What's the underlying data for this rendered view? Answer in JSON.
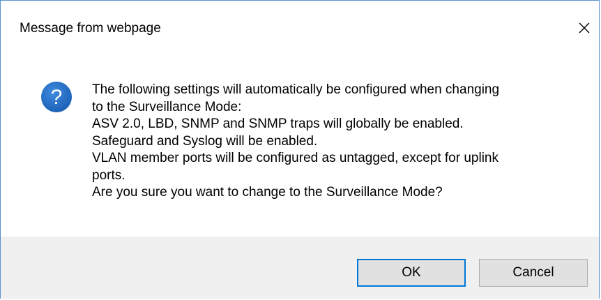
{
  "dialog": {
    "title": "Message from webpage",
    "close_icon": "close-icon",
    "icon": "question-icon",
    "message_lines": [
      "The following settings will automatically be configured when changing",
      "to the Surveillance Mode:",
      "ASV 2.0, LBD, SNMP and SNMP traps will globally be enabled.",
      "Safeguard and Syslog will be enabled.",
      "VLAN member ports will be configured as untagged, except for uplink",
      "ports.",
      "Are you sure you want to change to the Surveillance Mode?"
    ],
    "ok_label": "OK",
    "cancel_label": "Cancel"
  },
  "colors": {
    "border": "#5a8fd1",
    "icon_blue": "#1a5fb4",
    "footer_bg": "#f0f0f0",
    "button_bg": "#e1e1e1",
    "default_button_border": "#0078d7"
  }
}
